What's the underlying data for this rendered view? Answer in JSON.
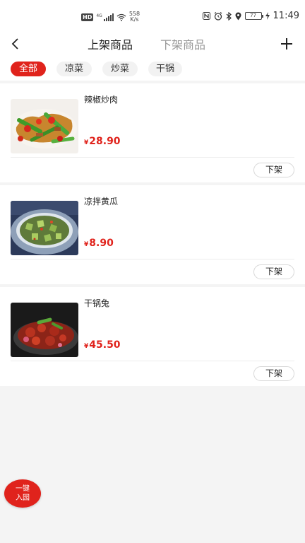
{
  "status_bar": {
    "hd": "HD",
    "network": "4G",
    "speed_value": "558",
    "speed_unit": "K/s",
    "battery": "77",
    "time": "11:49"
  },
  "header": {
    "tabs": [
      {
        "label": "上架商品",
        "active": true
      },
      {
        "label": "下架商品",
        "active": false
      }
    ]
  },
  "filters": [
    {
      "label": "全部",
      "active": true
    },
    {
      "label": "凉菜",
      "active": false
    },
    {
      "label": "炒菜",
      "active": false
    },
    {
      "label": "干锅",
      "active": false
    }
  ],
  "products": [
    {
      "name": "辣椒炒肉",
      "currency": "¥",
      "price": "28.90",
      "action": "下架"
    },
    {
      "name": "凉拌黄瓜",
      "currency": "¥",
      "price": "8.90",
      "action": "下架"
    },
    {
      "name": "干锅兔",
      "currency": "¥",
      "price": "45.50",
      "action": "下架"
    }
  ],
  "float_button": {
    "line1": "一键",
    "line2": "入园"
  },
  "colors": {
    "accent": "#e0231c",
    "background": "#f4f4f4"
  }
}
